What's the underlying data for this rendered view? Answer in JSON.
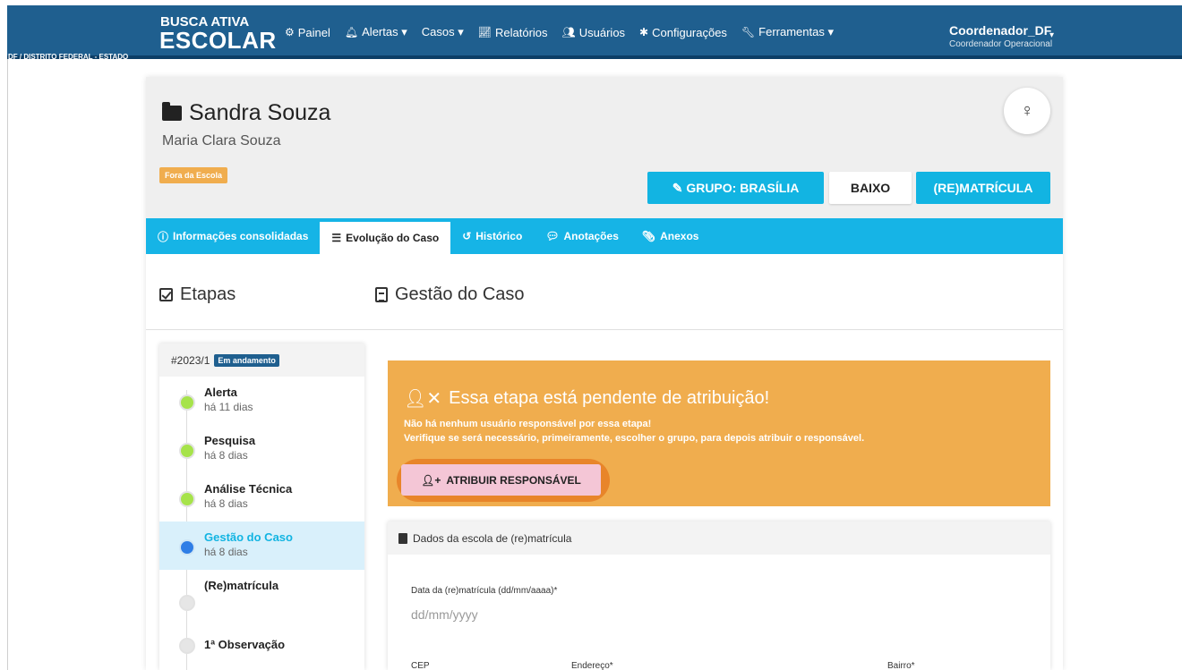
{
  "header": {
    "brand_line1": "BUSCA ATIVA",
    "brand_line2": "ESCOLAR",
    "brand_region": "DF / DISTRITO FEDERAL - ESTADO",
    "nav": [
      {
        "icon": "dashboard-icon",
        "label": "Painel"
      },
      {
        "icon": "bell-icon",
        "label": "Alertas ▾"
      },
      {
        "icon": "",
        "label": "Casos ▾"
      },
      {
        "icon": "chart-icon",
        "label": "Relatórios"
      },
      {
        "icon": "users-icon",
        "label": "Usuários"
      },
      {
        "icon": "gear-icon",
        "label": "Configurações"
      },
      {
        "icon": "wrench-icon",
        "label": "Ferramentas ▾"
      }
    ],
    "user_name": "Coordenador_DF",
    "user_role": "Coordenador Operacional"
  },
  "case": {
    "child_name": "Sandra Souza",
    "guardian_name": "Maria Clara Souza",
    "status_tag": "Fora da Escola",
    "gender_symbol": "♀",
    "group_button": "GRUPO: BRASÍLIA",
    "risk_button": "BAIXO",
    "step_button": "(RE)MATRÍCULA"
  },
  "tabs": [
    {
      "label": "Informações consolidadas",
      "icon": "info-icon"
    },
    {
      "label": "Evolução do Caso",
      "icon": "list-icon"
    },
    {
      "label": "Histórico",
      "icon": "history-icon"
    },
    {
      "label": "Anotações",
      "icon": "comments-icon"
    },
    {
      "label": "Anexos",
      "icon": "paperclip-icon"
    }
  ],
  "sections": {
    "steps_title": "Etapas",
    "management_title": "Gestão do Caso"
  },
  "steps_panel": {
    "case_id": "#2023/1",
    "status_badge": "Em andamento",
    "items": [
      {
        "title": "Alerta",
        "when": "há 11 dias",
        "state": "done"
      },
      {
        "title": "Pesquisa",
        "when": "há 8 dias",
        "state": "done"
      },
      {
        "title": "Análise Técnica",
        "when": "há 8 dias",
        "state": "done"
      },
      {
        "title": "Gestão do Caso",
        "when": "há 8 dias",
        "state": "current"
      },
      {
        "title": "(Re)matrícula",
        "when": "",
        "state": "pending"
      },
      {
        "title": "1ª Observação",
        "when": "",
        "state": "pending"
      }
    ]
  },
  "pending": {
    "title": "Essa etapa está pendente de atribuição!",
    "line1": "Não há nenhum usuário responsável por essa etapa!",
    "line2": "Verifique se será necessário, primeiramente, escolher o grupo, para depois atribuir o responsável.",
    "assign_button": "ATRIBUIR RESPONSÁVEL"
  },
  "school_data": {
    "title": "Dados da escola de (re)matrícula",
    "date_label": "Data da (re)matrícula (dd/mm/aaaa)*",
    "date_placeholder": "dd/mm/yyyy",
    "cep_label": "CEP",
    "address_label": "Endereço*",
    "district_label": "Bairro*"
  },
  "colors": {
    "navbar": "#1f5f8f",
    "accent": "#12b4e2",
    "warning": "#f0ad4e",
    "done_dot": "#a6e34a",
    "current_dot": "#2f7ee6"
  }
}
